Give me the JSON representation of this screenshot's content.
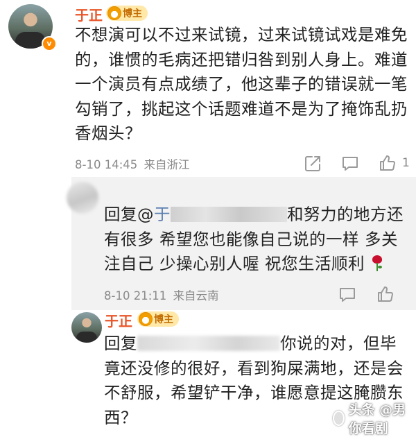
{
  "comment1": {
    "username": "于正",
    "badge_label": "博主",
    "verified_mark": "v",
    "text_lines": [
      "不想演可以不过来试镜，过来试镜试戏是难免",
      "的，谁惯的毛病还把错归咎到别人身上。难道",
      "一个演员有点成绩了，他这辈子的错误就一笔",
      "勾销了，挑起这个话题难道不是为了掩饰乱扔",
      "香烟头？"
    ],
    "time": "8-10 14:45",
    "location": "来自浙江",
    "like_count": "1",
    "icons": [
      "share-icon",
      "comment-icon",
      "like-icon"
    ]
  },
  "reply1": {
    "prefix": "回复@",
    "name_fragment": "于",
    "text_lines_first": "和努力的地方还",
    "text_lines": [
      "有很多 希望您也能像自己说的一样 多关",
      "注自己 少操心别人喔 祝您生活顺利"
    ],
    "emoji": "rose",
    "time": "8-10 21:11",
    "location": "来自云南"
  },
  "reply2": {
    "username": "于正",
    "badge_label": "博主",
    "prefix": "回复",
    "text_first": "你说的对，但毕",
    "text_lines": [
      "竟还没修的很好，看到狗屎满地，还是会",
      "不舒服，希望铲干净，谁愿意提这腌臜东",
      "西？"
    ]
  },
  "watermark": {
    "text": "头条 @男你看剧"
  },
  "colors": {
    "name": "#e8562a",
    "badge_bg": "#ffe8a8",
    "meta": "#8a8a8a",
    "reply_bg": "#f2f2f2"
  }
}
